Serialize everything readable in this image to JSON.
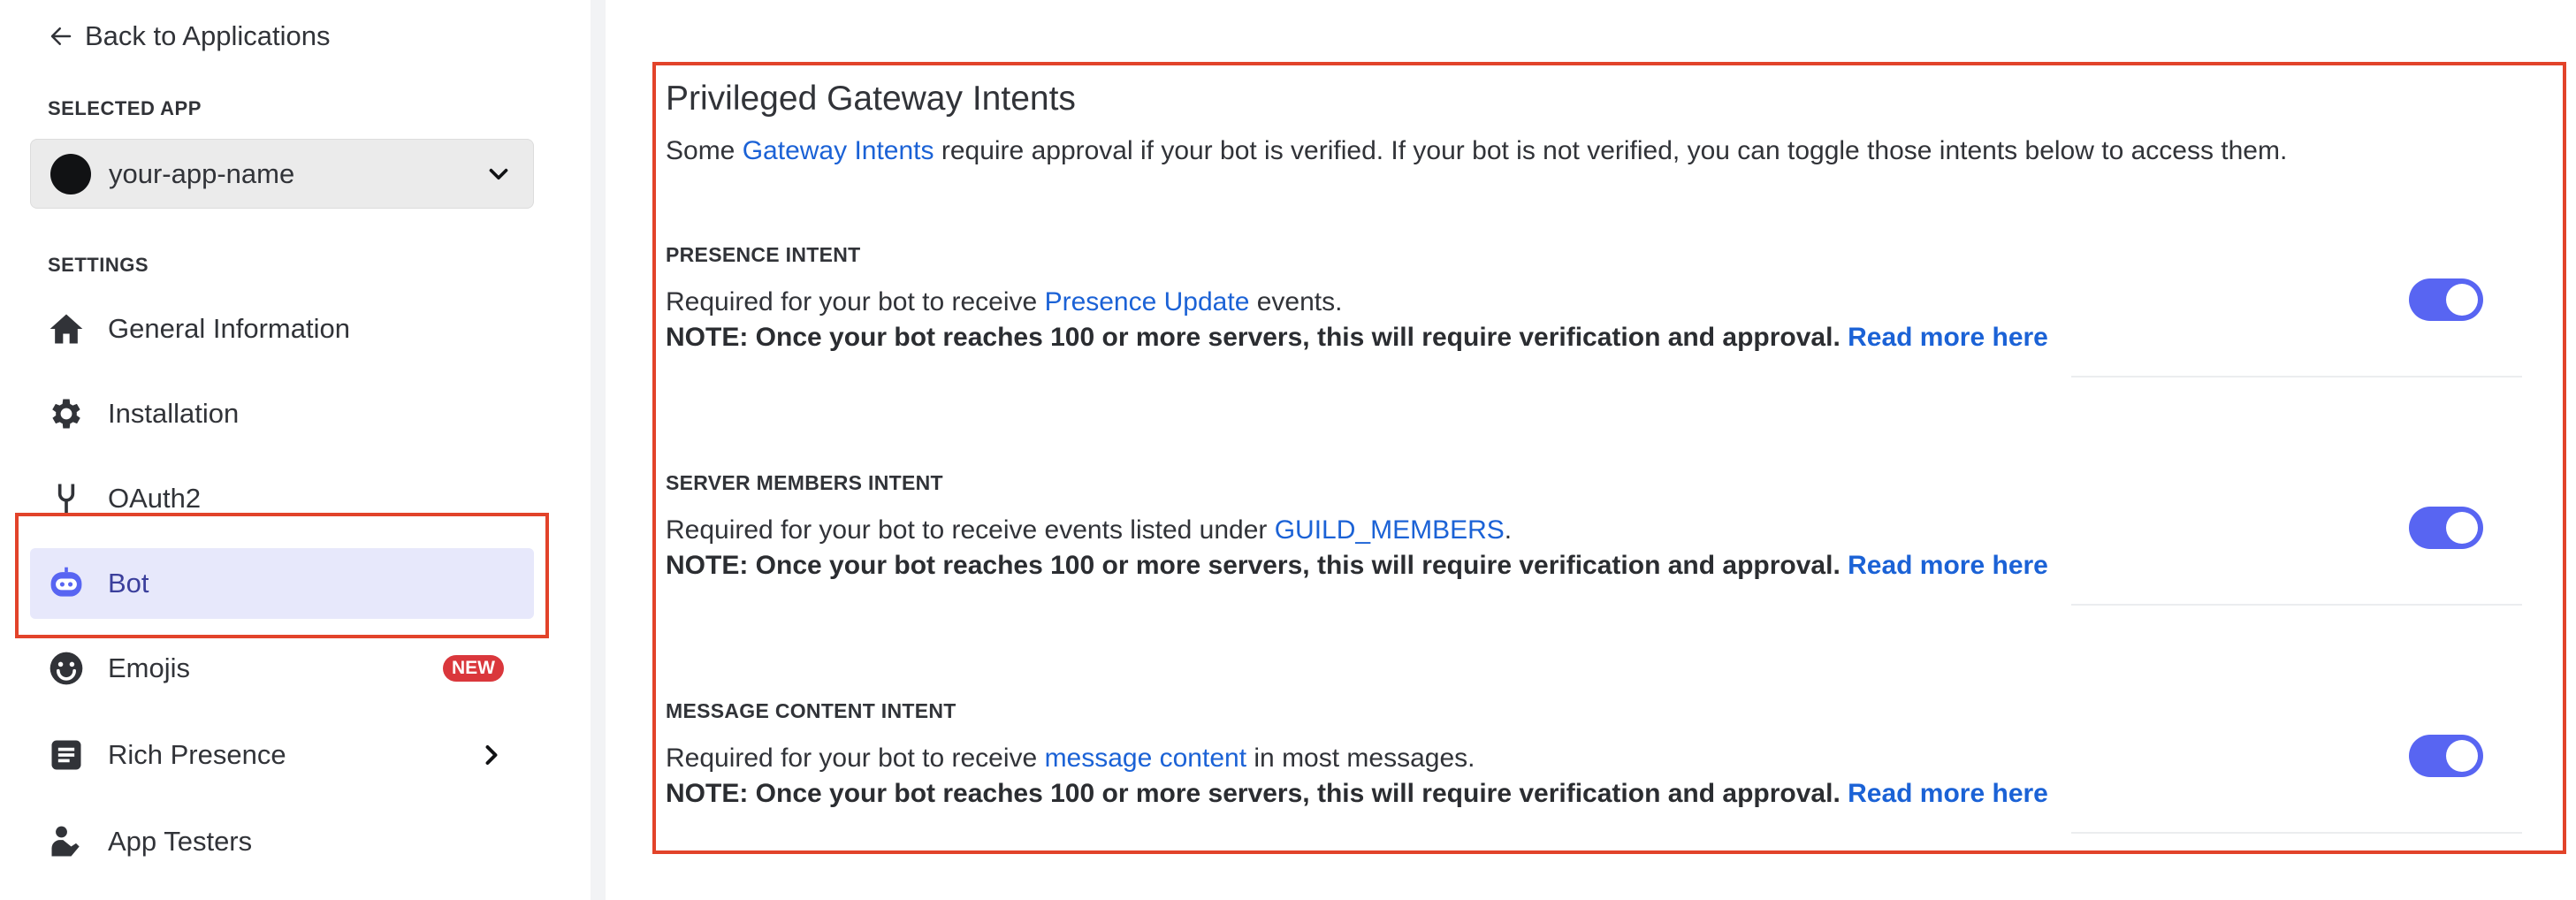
{
  "sidebar": {
    "back_label": "Back to Applications",
    "selected_app_heading": "SELECTED APP",
    "app_name": "your-app-name",
    "settings_heading": "SETTINGS",
    "items": [
      {
        "label": "General Information",
        "icon": "home-icon"
      },
      {
        "label": "Installation",
        "icon": "gear-icon"
      },
      {
        "label": "OAuth2",
        "icon": "wrench-icon"
      },
      {
        "label": "Bot",
        "icon": "bot-icon",
        "active": true
      },
      {
        "label": "Emojis",
        "icon": "smiley-icon",
        "badge": "NEW"
      },
      {
        "label": "Rich Presence",
        "icon": "document-icon",
        "expandable": true
      },
      {
        "label": "App Testers",
        "icon": "person-icon"
      }
    ]
  },
  "main": {
    "title": "Privileged Gateway Intents",
    "desc_prefix": "Some ",
    "desc_link": "Gateway Intents",
    "desc_suffix": " require approval if your bot is verified. If your bot is not verified, you can toggle those intents below to access them.",
    "intents": [
      {
        "heading": "PRESENCE INTENT",
        "desc_prefix": "Required for your bot to receive ",
        "desc_link": "Presence Update",
        "desc_suffix": " events.",
        "note": "NOTE: Once your bot reaches 100 or more servers, this will require verification and approval. ",
        "read_more": "Read more here",
        "enabled": true
      },
      {
        "heading": "SERVER MEMBERS INTENT",
        "desc_prefix": "Required for your bot to receive events listed under ",
        "desc_link": "GUILD_MEMBERS",
        "desc_suffix": ".",
        "note": "NOTE: Once your bot reaches 100 or more servers, this will require verification and approval. ",
        "read_more": "Read more here",
        "enabled": true
      },
      {
        "heading": "MESSAGE CONTENT INTENT",
        "desc_prefix": "Required for your bot to receive ",
        "desc_link": "message content",
        "desc_suffix": " in most messages.",
        "note": "NOTE: Once your bot reaches 100 or more servers, this will require verification and approval. ",
        "read_more": "Read more here",
        "enabled": true
      }
    ]
  },
  "colors": {
    "accent": "#5865f2",
    "link": "#1b62d6",
    "highlight": "#e2432a",
    "active_bg": "#e7e8fb"
  }
}
